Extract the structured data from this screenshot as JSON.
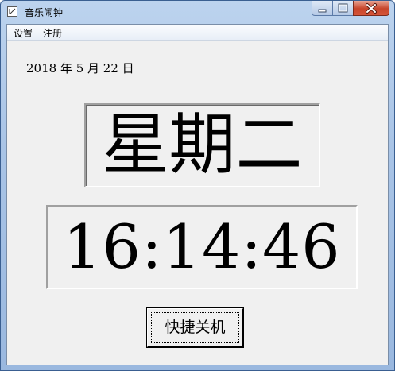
{
  "window": {
    "title": "音乐闹钟"
  },
  "menu": {
    "items": [
      {
        "label": "设置"
      },
      {
        "label": "注册"
      }
    ]
  },
  "clock": {
    "date": "2018 年 5 月 22 日",
    "weekday": "星期二",
    "time": "16:14:46"
  },
  "actions": {
    "shutdown_label": "快捷关机"
  },
  "icons": {
    "app": "app-window-icon",
    "minimize": "minimize-icon",
    "maximize": "maximize-icon",
    "close": "close-icon"
  },
  "colors": {
    "titlebar": "#a9c4e6",
    "client_background": "#f0f0f0",
    "close_button": "#c7442a",
    "text": "#000000"
  }
}
